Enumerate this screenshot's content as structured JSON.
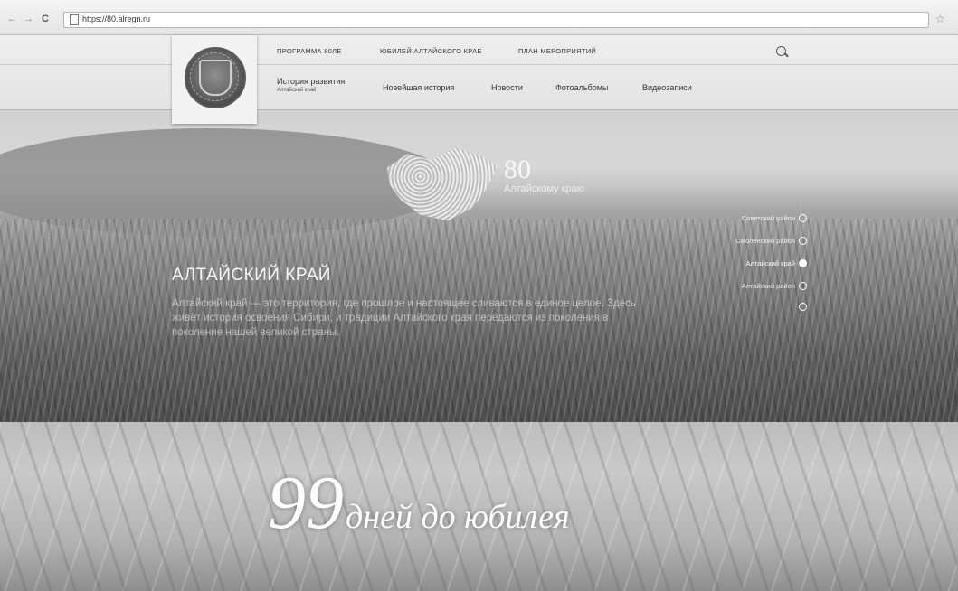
{
  "browser": {
    "url": "https://80.alregn.ru",
    "back_icon": "arrow-left-icon",
    "forward_icon": "arrow-right-icon",
    "reload_icon": "reload-icon",
    "bookmark_icon": "star-icon"
  },
  "header": {
    "top_nav": [
      {
        "label": "ПРОГРАММА 80ЛЕ"
      },
      {
        "label": "ЮБИЛЕЙ АЛТАЙСКОГО КРАЕ"
      },
      {
        "label": "ПЛАН МЕРОПРИЯТИЙ"
      }
    ],
    "history_title": "История развития",
    "history_subtitle": "Алтайский край",
    "main_nav": [
      {
        "label": "Новейшая история"
      },
      {
        "label": "Новости"
      },
      {
        "label": "Фотоальбомы"
      },
      {
        "label": "Видеозаписи"
      }
    ]
  },
  "hero": {
    "emblem_label_big": "80",
    "emblem_label_small": "Алтайскому краю",
    "title": "АЛТАЙСКИЙ КРАЙ",
    "paragraph": "Алтайский край — это территория, где прошлое и настоящее сливаются в единое целое. Здесь живёт история освоения Сибири, и традиции Алтайского края передаются из поколения в поколение нашей великой страны.",
    "regions": [
      {
        "label": "Советский район",
        "active": false
      },
      {
        "label": "Смоленский район",
        "active": false
      },
      {
        "label": "Алтайский край",
        "active": true
      },
      {
        "label": "Алтайский район",
        "active": false
      },
      {
        "label": "",
        "active": false
      }
    ]
  },
  "countdown": {
    "number": "99",
    "text": "дней до юбилея"
  }
}
